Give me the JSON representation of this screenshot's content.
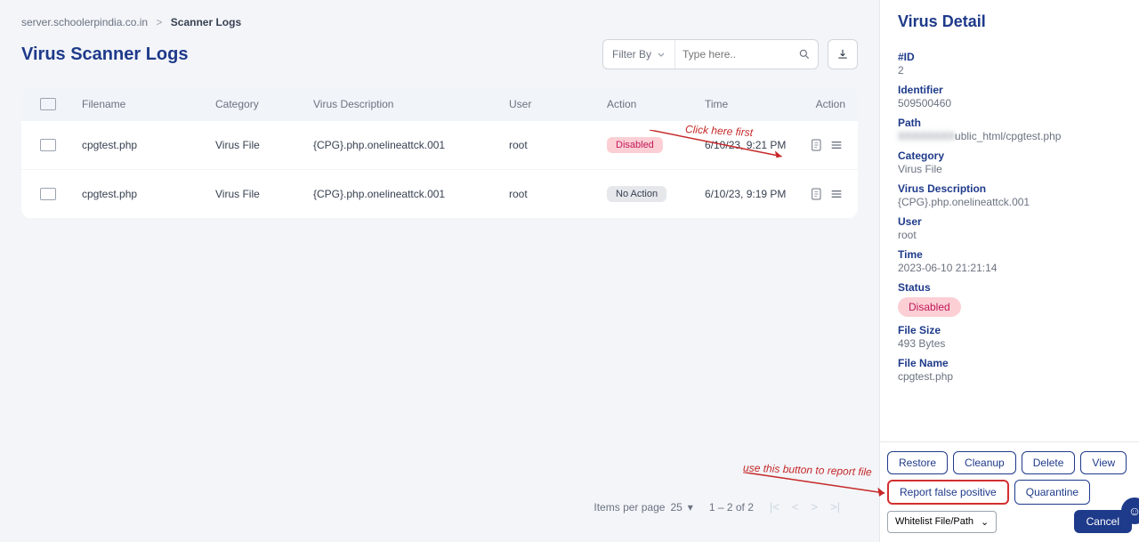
{
  "breadcrumb": {
    "path": "server.schoolerpindia.co.in",
    "current": "Scanner Logs"
  },
  "title": "Virus Scanner Logs",
  "filter": {
    "label": "Filter By",
    "placeholder": "Type here.."
  },
  "headers": {
    "filename": "Filename",
    "category": "Category",
    "desc": "Virus Description",
    "user": "User",
    "action": "Action",
    "time": "Time",
    "actcol": "Action"
  },
  "rows": [
    {
      "filename": "cpgtest.php",
      "category": "Virus File",
      "desc": "{CPG}.php.onelineattck.001",
      "user": "root",
      "status": "Disabled",
      "time": "6/10/23, 9:21 PM"
    },
    {
      "filename": "cpgtest.php",
      "category": "Virus File",
      "desc": "{CPG}.php.onelineattck.001",
      "user": "root",
      "status": "No Action",
      "time": "6/10/23, 9:19 PM"
    }
  ],
  "pagination": {
    "items_label": "Items per page",
    "size": "25",
    "range": "1 – 2 of 2"
  },
  "side": {
    "title": "Virus Detail",
    "labels": {
      "id": "#ID",
      "ident": "Identifier",
      "path": "Path",
      "cat": "Category",
      "vdesc": "Virus Description",
      "user": "User",
      "time": "Time",
      "status": "Status",
      "fsize": "File Size",
      "fname": "File Name"
    },
    "values": {
      "id": "2",
      "ident": "509500460",
      "path_blur": "XXXXXXXX",
      "path_rest": "ublic_html/cpgtest.php",
      "cat": "Virus File",
      "vdesc": "{CPG}.php.onelineattck.001",
      "user": "root",
      "time": "2023-06-10 21:21:14",
      "status": "Disabled",
      "fsize": "493 Bytes",
      "fname": "cpgtest.php"
    }
  },
  "actions": {
    "restore": "Restore",
    "cleanup": "Cleanup",
    "delete": "Delete",
    "view": "View",
    "report": "Report false positive",
    "quarantine": "Quarantine",
    "whitelist": "Whitelist File/Path",
    "cancel": "Cancel"
  },
  "anno": {
    "first": "Click here first",
    "second": "use this button to report file"
  }
}
